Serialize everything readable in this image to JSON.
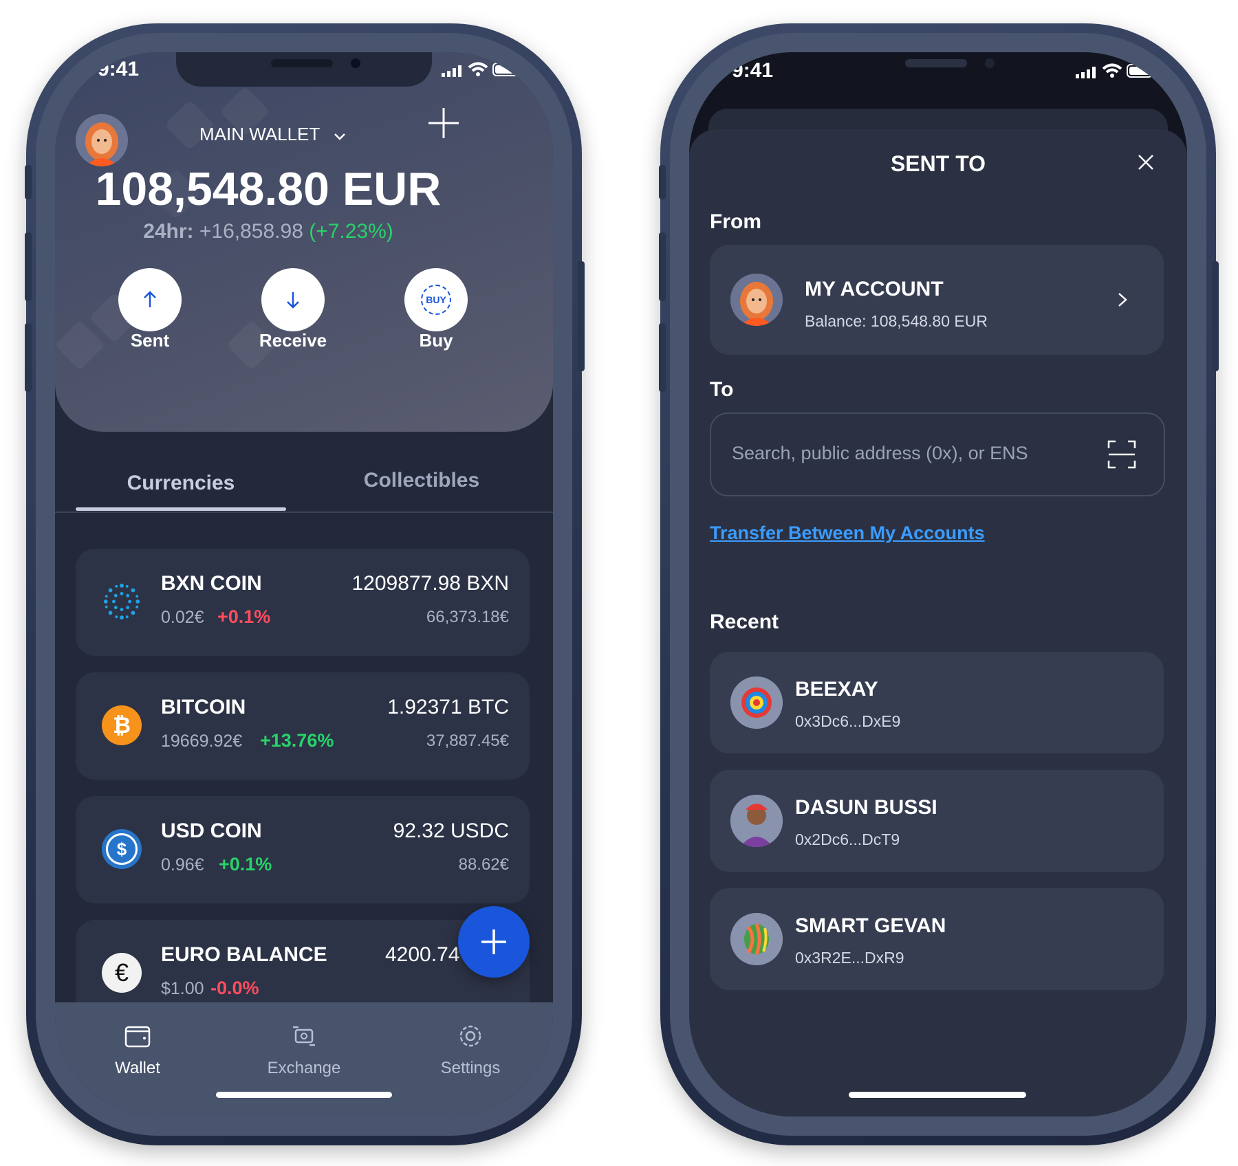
{
  "left_screen": {
    "status_time": "9:41",
    "wallet_selector": "MAIN WALLET",
    "balance": "108,548.80 EUR",
    "change_label": "24hr:",
    "change_value": "+16,858.98",
    "change_percent": "(+7.23%)",
    "actions": [
      {
        "label": "Sent",
        "icon": "arrow-up-icon"
      },
      {
        "label": "Receive",
        "icon": "arrow-down-icon"
      },
      {
        "label": "Buy",
        "icon": "buy-icon",
        "icon_text": "BUY"
      }
    ],
    "tabs": [
      {
        "label": "Currencies",
        "active": true
      },
      {
        "label": "Collectibles",
        "active": false
      }
    ],
    "assets": [
      {
        "name": "BXN COIN",
        "price": "0.02€",
        "change": "+0.1%",
        "change_color": "#ff4d5e",
        "amount": "1209877.98 BXN",
        "value": "66,373.18€",
        "icon": "bxn-coin-icon"
      },
      {
        "name": "BITCOIN",
        "price": "19669.92€",
        "change": "+13.76%",
        "change_color": "#27d36a",
        "amount": "1.92371 BTC",
        "value": "37,887.45€",
        "icon": "bitcoin-icon"
      },
      {
        "name": "USD COIN",
        "price": "0.96€",
        "change": "+0.1%",
        "change_color": "#27d36a",
        "amount": "92.32 USDC",
        "value": "88.62€",
        "icon": "usd-coin-icon"
      },
      {
        "name": "EURO BALANCE",
        "price": "$1.00",
        "change": "-0.0%",
        "change_color": "#ff4d5e",
        "amount": "4200.74",
        "value": "",
        "icon": "euro-icon"
      }
    ],
    "nav": [
      {
        "label": "Wallet",
        "icon": "wallet-icon",
        "active": true
      },
      {
        "label": "Exchange",
        "icon": "exchange-icon",
        "active": false
      },
      {
        "label": "Settings",
        "icon": "gear-icon",
        "active": false
      }
    ]
  },
  "right_screen": {
    "status_time": "9:41",
    "title": "SENT TO",
    "from_label": "From",
    "account_name": "MY ACCOUNT",
    "account_balance": "Balance: 108,548.80 EUR",
    "to_label": "To",
    "search_placeholder": "Search, public address (0x), or ENS",
    "transfer_link": "Transfer Between My Accounts",
    "recent_label": "Recent",
    "recent": [
      {
        "name": "BEEXAY",
        "address": "0x3Dc6...DxE9"
      },
      {
        "name": "DASUN BUSSI",
        "address": "0x2Dc6...DcT9"
      },
      {
        "name": "SMART GEVAN",
        "address": "0x3R2E...DxR9"
      }
    ]
  },
  "colors": {
    "accent_blue": "#1a56db",
    "link_blue": "#3b9cff",
    "green": "#27d36a",
    "red": "#ff4d5e",
    "card_bg": "#2d3346",
    "screen_bg": "#23293a"
  }
}
